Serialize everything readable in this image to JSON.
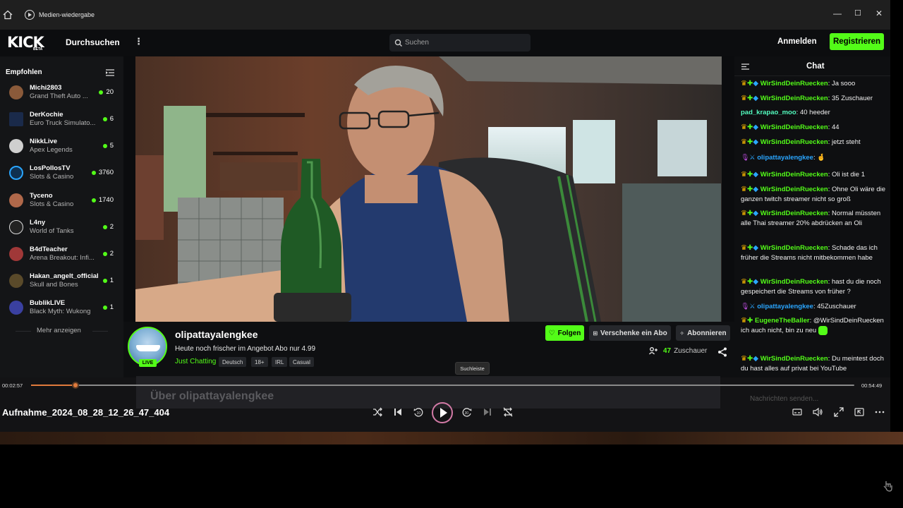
{
  "window": {
    "title": "Medien-wiedergabe"
  },
  "header": {
    "logo": "KICK",
    "logo_badge": "BETA",
    "browse": "Durchsuchen",
    "search_placeholder": "Suchen",
    "login": "Anmelden",
    "register": "Registrieren"
  },
  "sidebar": {
    "heading": "Empfohlen",
    "show_more": "Mehr anzeigen",
    "items": [
      {
        "name": "Michi2803",
        "category": "Grand Theft Auto ...",
        "viewers": "20"
      },
      {
        "name": "DerKochie",
        "category": "Euro Truck Simulato...",
        "viewers": "6"
      },
      {
        "name": "NikkLive",
        "category": "Apex Legends",
        "viewers": "5"
      },
      {
        "name": "LosPollosTV",
        "category": "Slots & Casino",
        "viewers": "3760"
      },
      {
        "name": "Tyceno",
        "category": "Slots & Casino",
        "viewers": "1740"
      },
      {
        "name": "L4ny",
        "category": "World of Tanks",
        "viewers": "2"
      },
      {
        "name": "B4dTeacher",
        "category": "Arena Breakout: Infi...",
        "viewers": "2"
      },
      {
        "name": "Hakan_angelt_official",
        "category": "Skull and Bones",
        "viewers": "1"
      },
      {
        "name": "BublikLIVE",
        "category": "Black Myth: Wukong",
        "viewers": "1"
      }
    ]
  },
  "stream": {
    "channel": "olipattayalengkee",
    "title": "Heute noch frischer im Angebot Abo nur 4.99",
    "category": "Just Chatting",
    "tags": [
      "Deutsch",
      "18+",
      "IRL",
      "Casual"
    ],
    "live_badge": "LIVE",
    "follow": "Folgen",
    "gift": "Verschenke ein Abo",
    "subscribe": "Abonnieren",
    "viewer_count": "47",
    "viewer_label": "Zuschauer",
    "about": "Über olipattayalengkee"
  },
  "chat": {
    "title": "Chat",
    "input_placeholder": "Nachrichten senden...",
    "messages": [
      {
        "user": "WirSindDeinRuecken",
        "text": "Ja sooo"
      },
      {
        "user": "WirSindDeinRuecken",
        "text": "35 Zuschauer"
      },
      {
        "user": "pad_krapao_moo",
        "text": "40 heeder"
      },
      {
        "user": "WirSindDeinRuecken",
        "text": "44"
      },
      {
        "user": "WirSindDeinRuecken",
        "text": "jetzt steht"
      },
      {
        "user": "olipattayalengkee",
        "text": ""
      },
      {
        "user": "WirSindDeinRuecken",
        "text": "Oli ist die 1"
      },
      {
        "user": "WirSindDeinRuecken",
        "text": "Ohne Oli wäre die ganzen twitch streamer nicht so groß"
      },
      {
        "user": "WirSindDeinRuecken",
        "text": "Normal müssten alle Thai streamer 20% abdrücken an Oli"
      },
      {
        "user": "WirSindDeinRuecken",
        "text": "Schade das ich früher die Streams nicht mitbekommen habe"
      },
      {
        "user": "WirSindDeinRuecken",
        "text": "hast du die noch gespeichert die Streams von früher ?"
      },
      {
        "user": "olipattayalengkee",
        "text": "45Zuschauer"
      },
      {
        "user": "EugeneTheBaller",
        "text": "@WirSindDeinRuecken ich auch nicht, bin zu neu"
      },
      {
        "user": "WirSindDeinRuecken",
        "text": "Du meintest doch du hast alles auf privat bei YouTube"
      }
    ]
  },
  "player": {
    "filename": "Aufnahme_2024_08_28_12_26_47_404",
    "elapsed": "00:02:57",
    "total": "00:54:49",
    "progress": 0.054,
    "tooltip": "Suchleiste"
  },
  "colors": {
    "accent": "#53fc18",
    "progress": "#e07a3c",
    "username": "#53fc18",
    "streamer": "#2aa6ff"
  }
}
